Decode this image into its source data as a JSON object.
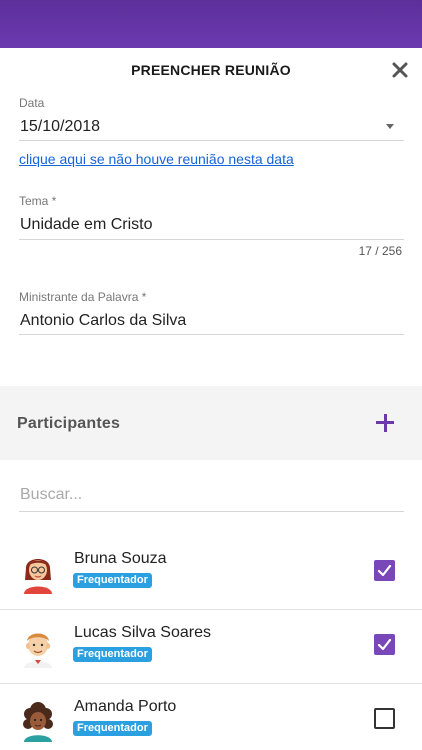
{
  "header": {
    "title": "PREENCHER REUNIÃO",
    "close_icon": "close-icon"
  },
  "form": {
    "date": {
      "label": "Data",
      "value": "15/10/2018"
    },
    "no_meeting_link": "clique aqui se não houve reunião nesta data",
    "theme": {
      "label": "Tema *",
      "value": "Unidade em Cristo",
      "counter": "17 / 256"
    },
    "minister": {
      "label": "Ministrante da Palavra *",
      "value": "Antonio Carlos da Silva"
    }
  },
  "participants": {
    "title": "Participantes",
    "add_icon": "plus-icon",
    "search_placeholder": "Buscar...",
    "items": [
      {
        "name": "Bruna Souza",
        "badge": "Frequentador",
        "checked": true
      },
      {
        "name": "Lucas Silva Soares",
        "badge": "Frequentador",
        "checked": true
      },
      {
        "name": "Amanda Porto",
        "badge": "Frequentador",
        "checked": false
      }
    ]
  },
  "colors": {
    "topbar": "#5c2f9a",
    "accent": "#7a47b8",
    "link": "#1565d8",
    "badge": "#2aa0e0"
  }
}
